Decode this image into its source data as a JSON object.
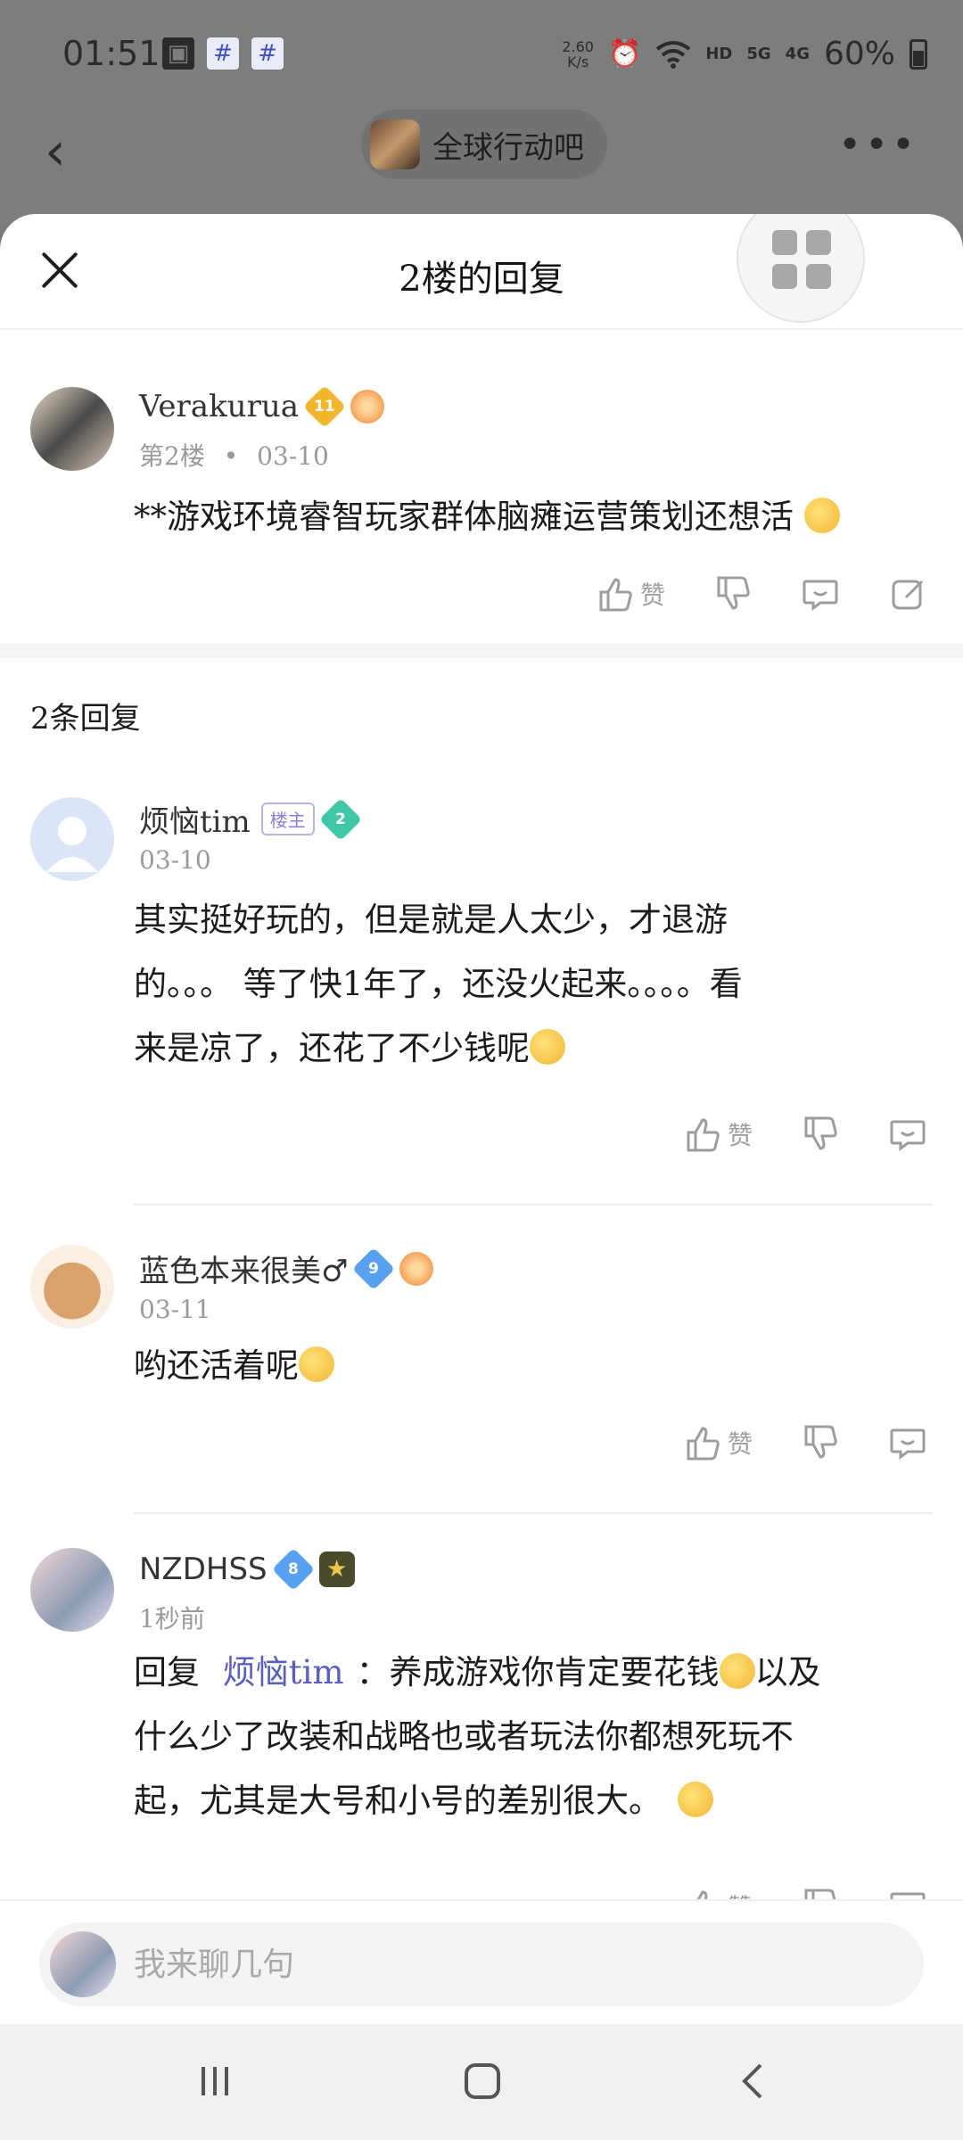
{
  "status_bar": {
    "time": "01:51",
    "net_speed_value": "2.60",
    "net_speed_unit": "K/s",
    "battery": "60%",
    "icons": [
      "image-icon",
      "hash-icon",
      "hash-icon",
      "alarm-icon",
      "wifi-icon",
      "hd-icon",
      "signal-5g-icon",
      "signal-4g-icon",
      "battery-icon"
    ],
    "hd": "HD",
    "sig5": "5G",
    "sig4": "4G"
  },
  "topnav": {
    "forum_name": "全球行动吧"
  },
  "sheet": {
    "title": "2楼的回复"
  },
  "main_post": {
    "username": "Verakurua",
    "level": "11",
    "floor": "第2楼",
    "date": "03-10",
    "content": "**游戏环境睿智玩家群体脑瘫运营策划还想活",
    "like_label": "赞"
  },
  "replies_section": {
    "title": "2条回复"
  },
  "replies": [
    {
      "username": "烦恼tim",
      "host_tag": "楼主",
      "level": "2",
      "date": "03-10",
      "content_line1": "其实挺好玩的，但是就是人太少，才退游",
      "content_line2": "的。。。 等了快1年了，还没火起来。。。。看",
      "content_line3": "来是凉了，还花了不少钱呢",
      "like_label": "赞"
    },
    {
      "username": "蓝色本来很美♂",
      "level": "9",
      "date": "03-11",
      "content": "哟还活着呢",
      "like_label": "赞"
    },
    {
      "username": "NZDHSS",
      "level": "8",
      "date": "1秒前",
      "reply_prefix": "回复",
      "mention": "烦恼tim",
      "content_line1": "：养成游戏你肯定要花钱",
      "content_line1_tail": "以及",
      "content_line2": "什么少了改装和战略也或者玩法你都想死玩不",
      "content_line3": "起，尤其是大号和小号的差别很大。",
      "like_label": "赞"
    }
  ],
  "input": {
    "placeholder": "我来聊几句"
  },
  "colors": {
    "accent": "#5a5fbd",
    "gold_badge": "#f2b52e",
    "teal_badge": "#3fc7a6",
    "blue_badge": "#5aa0f0"
  }
}
